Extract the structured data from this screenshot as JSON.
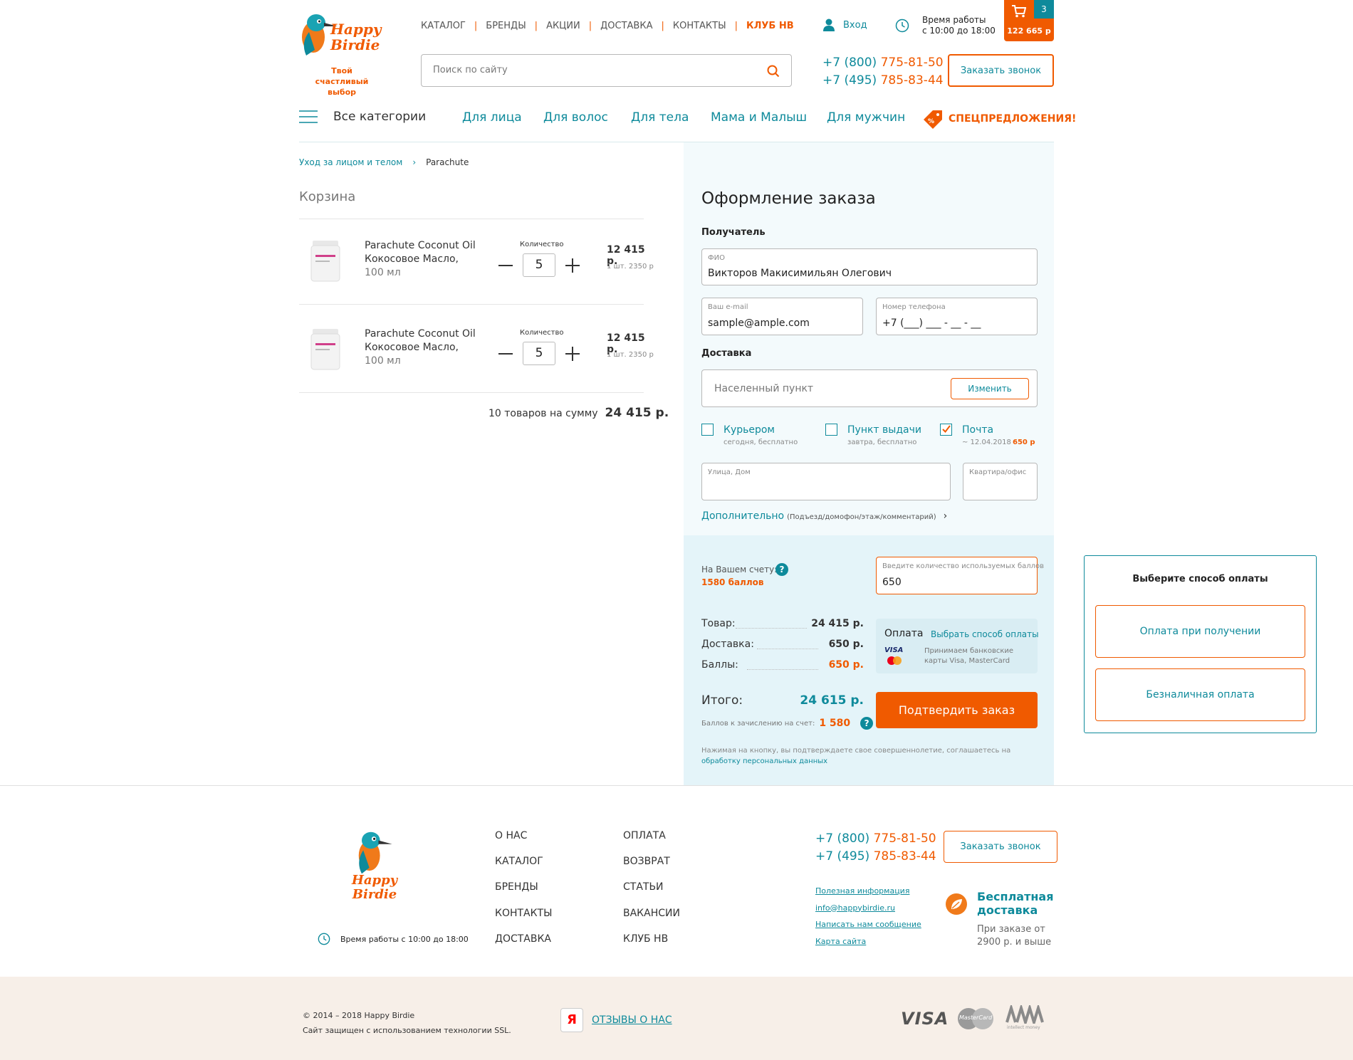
{
  "header": {
    "logo_text": "Happy Birdie",
    "tagline": "Твой счастливый выбор",
    "nav": [
      "КАТАЛОГ",
      "БРЕНДЫ",
      "АКЦИИ",
      "ДОСТАВКА",
      "КОНТАКТЫ",
      "КЛУБ НВ"
    ],
    "login": "Вход",
    "hours_label": "Время работы",
    "hours_value": "с 10:00 до 18:00",
    "cart_count": "3",
    "cart_total": "122 665 р",
    "search_placeholder": "Поиск по сайту",
    "phone1_prefix": "+7 (800)",
    "phone1_number": "775-81-50",
    "phone2_prefix": "+7 (495)",
    "phone2_number": "785-83-44",
    "callback": "Заказать звонок"
  },
  "categories": {
    "all": "Все категории",
    "items": [
      "Для лица",
      "Для волос",
      "Для тела",
      "Мама и Малыш",
      "Для мужчин"
    ],
    "special": "СПЕЦПРЕДЛОЖЕНИЯ!"
  },
  "breadcrumb": {
    "parent": "Уход за лицом и телом",
    "current": "Parachute"
  },
  "cart": {
    "title": "Корзина",
    "qty_label": "Количество",
    "items": [
      {
        "name1": "Parachute Coconut Oil",
        "name2": "Кокосовое Масло,",
        "volume": "100 мл",
        "qty": "5",
        "price": "12 415 р.",
        "unit": "1 шт. 2350 р"
      },
      {
        "name1": "Parachute Coconut Oil",
        "name2": "Кокосовое Масло,",
        "volume": "100 мл",
        "qty": "5",
        "price": "12 415 р.",
        "unit": "1 шт. 2350 р"
      }
    ],
    "summary_label": "10 товаров на сумму",
    "summary_total": "24 415 р."
  },
  "order": {
    "title": "Оформление заказа",
    "recipient": "Получатель",
    "fio_label": "ФИО",
    "fio_value": "Викторов Макисимильян Олегович",
    "email_label": "Ваш e-mail",
    "email_value": "sample@ample.com",
    "phone_label": "Номер телефона",
    "phone_value": "+7 (___) ___ - __ - __",
    "delivery": "Доставка",
    "city_placeholder": "Населенный пункт",
    "change": "Изменить",
    "options": [
      {
        "label": "Курьером",
        "sub": "сегодня, бесплатно",
        "price": "",
        "checked": false
      },
      {
        "label": "Пункт выдачи",
        "sub": "завтра, бесплатно",
        "price": "",
        "checked": false
      },
      {
        "label": "Почта",
        "sub": "~ 12.04.2018",
        "price": "650 р",
        "checked": true
      }
    ],
    "street_label": "Улица, Дом",
    "apt_label": "Квартира/офис",
    "extra_link": "Дополнительно",
    "extra_hint": "(Подъезд/домофон/этаж/комментарий)",
    "account_label": "На Вашем счету:",
    "account_points": "1580 баллов",
    "points_input_label": "Введите количество используемых баллов",
    "points_input_value": "650",
    "goods_label": "Товар:",
    "goods_value": "24 415 р.",
    "delivery_label": "Доставка:",
    "delivery_value": "650 р.",
    "points_label": "Баллы:",
    "points_value": "650 р.",
    "payment_label": "Оплата",
    "payment_choose": "Выбрать способ оплаты",
    "payment_note": "Принимаем банковские карты Visa, MasterCard",
    "total_label": "Итого:",
    "total_value": "24 615 р.",
    "bonus_label": "Баллов к зачислению на счет:",
    "bonus_value": "1 580",
    "confirm": "Подтвердить заказ",
    "disclaimer": "Нажимая на кнопку, вы подтверждаете свое совершеннолетие, соглашаетесь на",
    "disclaimer_link": "обработку персональных данных"
  },
  "payment_popup": {
    "title": "Выберите способ оплаты",
    "option1": "Оплата при получении",
    "option2": "Безналичная оплата"
  },
  "footer": {
    "col1": [
      "О НАС",
      "КАТАЛОГ",
      "БРЕНДЫ",
      "КОНТАКТЫ",
      "ДОСТАВКА"
    ],
    "col2": [
      "ОПЛАТА",
      "ВОЗВРАТ",
      "СТАТЬИ",
      "ВАКАНСИИ",
      "КЛУБ НВ"
    ],
    "hours": "Время работы с 10:00 до 18:00",
    "phone1_prefix": "+7 (800)",
    "phone1_number": "775-81-50",
    "phone2_prefix": "+7 (495)",
    "phone2_number": "785-83-44",
    "callback": "Заказать звонок",
    "links": [
      "Полезная информация",
      "info@happybirdie.ru",
      "Написать нам сообщение",
      "Карта сайта"
    ],
    "free_title1": "Бесплатная",
    "free_title2": "доставка",
    "free_sub1": "При заказе от",
    "free_sub2": "2900 р. и выше",
    "copyright": "© 2014 – 2018 Happy Birdie",
    "ssl": "Сайт защищен с использованием технологии SSL.",
    "reviews": "ОТЗЫВЫ О НАС",
    "yandex": "Я",
    "visa": "VISA",
    "mastercard": "MasterCard",
    "intellect": "intellect money"
  }
}
